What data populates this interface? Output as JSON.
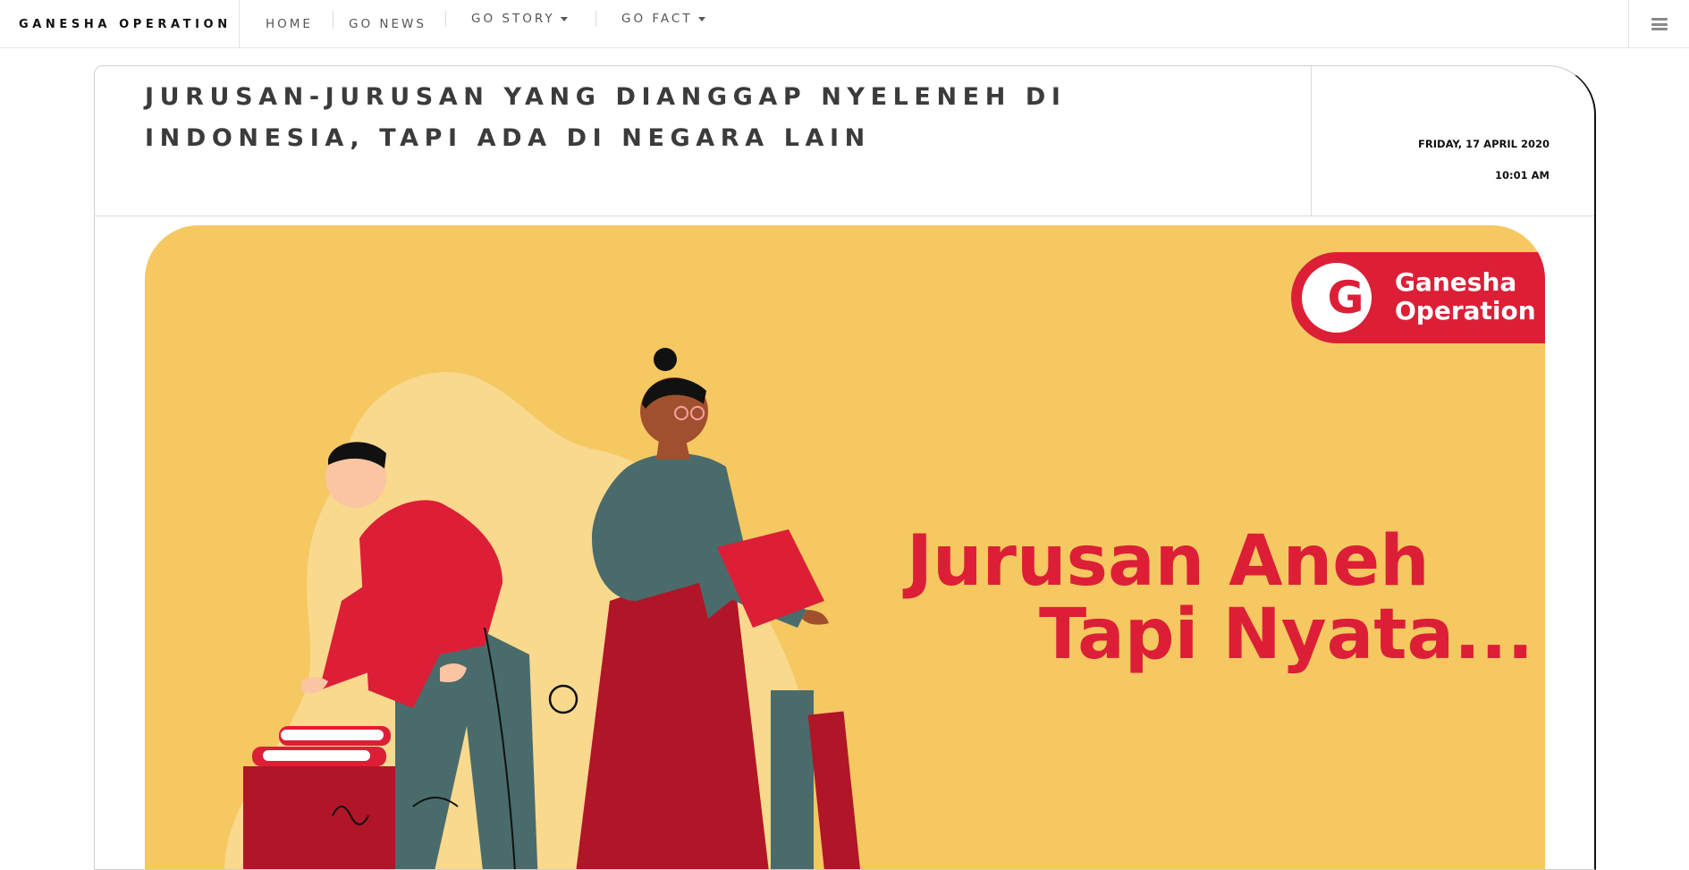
{
  "nav": {
    "brand": "GANESHA OPERATION",
    "items": [
      {
        "label": "HOME",
        "dropdown": false
      },
      {
        "label": "GO NEWS",
        "dropdown": false
      },
      {
        "label": "GO STORY",
        "dropdown": true
      },
      {
        "label": "GO FACT",
        "dropdown": true
      }
    ],
    "menu_icon": "hamburger-menu-icon"
  },
  "article": {
    "title": "JURUSAN-JURUSAN YANG DIANGGAP NYELENEH DI INDONESIA, TAPI ADA DI NEGARA LAIN",
    "date": "FRIDAY, 17 APRIL 2020",
    "time": "10:01 AM"
  },
  "hero": {
    "logo_letter": "G",
    "logo_line1": "Ganesha",
    "logo_line2": "Operation",
    "headline_line1": "Jurusan Aneh",
    "headline_line2": "Tapi Nyata..."
  },
  "colors": {
    "brand_red": "#dc1f37",
    "hero_yellow": "#f5c862",
    "text_dark": "#3b3b3b"
  }
}
